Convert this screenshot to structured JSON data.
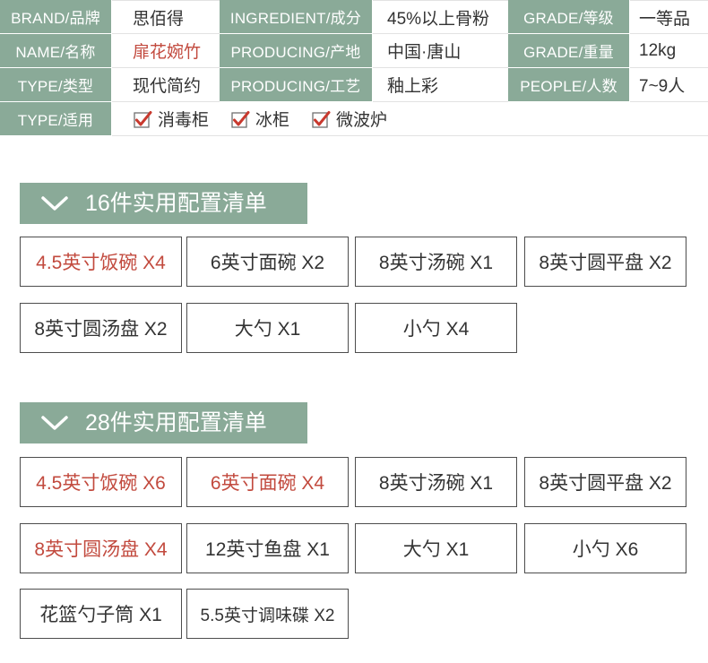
{
  "spec_table": {
    "rows": [
      {
        "cells": [
          {
            "label": "BRAND/品牌",
            "value": "思佰得"
          },
          {
            "label": "INGREDIENT/成分",
            "value": "45%以上骨粉"
          },
          {
            "label": "GRADE/等级",
            "value": "一等品"
          }
        ]
      },
      {
        "cells": [
          {
            "label": "NAME/名称",
            "value": "扉花婉竹",
            "highlight": true
          },
          {
            "label": "PRODUCING/产地",
            "value": "中国·唐山"
          },
          {
            "label": "GRADE/重量",
            "value": "12kg"
          }
        ]
      },
      {
        "cells": [
          {
            "label": "TYPE/类型",
            "value": "现代简约"
          },
          {
            "label": "PRODUCING/工艺",
            "value": "釉上彩"
          },
          {
            "label": "PEOPLE/人数",
            "value": "7~9人"
          }
        ]
      }
    ],
    "usage": {
      "label": "TYPE/适用",
      "options": [
        {
          "text": "消毒柜",
          "checked": true,
          "icon": "checkbox-checked-icon"
        },
        {
          "text": "冰柜",
          "checked": true,
          "icon": "checkbox-checked-icon"
        },
        {
          "text": "微波炉",
          "checked": true,
          "icon": "checkbox-checked-icon"
        }
      ]
    }
  },
  "sections": [
    {
      "title": "16件实用配置清单",
      "icon": "chevron-down-icon",
      "items": [
        {
          "text": "4.5英寸饭碗 X4",
          "highlight": true
        },
        {
          "text": "6英寸面碗 X2"
        },
        {
          "text": "8英寸汤碗 X1"
        },
        {
          "text": "8英寸圆平盘 X2"
        },
        {
          "text": "8英寸圆汤盘 X2"
        },
        {
          "text": "大勺 X1"
        },
        {
          "text": "小勺 X4"
        }
      ]
    },
    {
      "title": "28件实用配置清单",
      "icon": "chevron-down-icon",
      "items": [
        {
          "text": "4.5英寸饭碗 X6",
          "highlight": true
        },
        {
          "text": "6英寸面碗 X4",
          "highlight": true
        },
        {
          "text": "8英寸汤碗 X1"
        },
        {
          "text": "8英寸圆平盘 X2"
        },
        {
          "text": "8英寸圆汤盘 X4",
          "highlight": true
        },
        {
          "text": "12英寸鱼盘 X1"
        },
        {
          "text": "大勺 X1"
        },
        {
          "text": "小勺 X6"
        },
        {
          "text": "花篮勺子筒 X1"
        },
        {
          "text": "5.5英寸调味碟 X2"
        }
      ]
    }
  ],
  "colors": {
    "label_bg": "#8aaa98",
    "highlight_text": "#c24a3e",
    "text": "#333333",
    "item_border": "#4d4d4d",
    "check_mark": "#c8392e"
  }
}
